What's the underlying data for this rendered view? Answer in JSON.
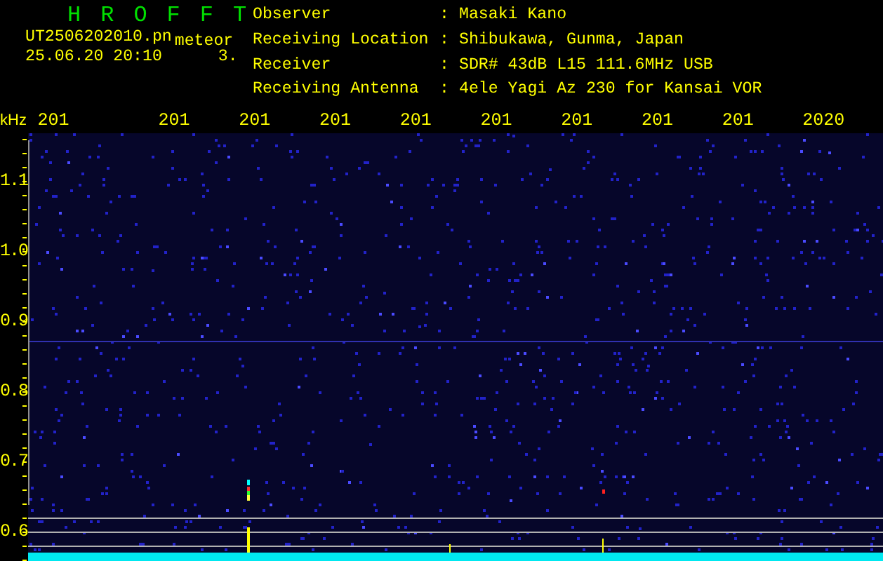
{
  "app": {
    "title": "HROFFT",
    "filename": "UT2506202010.pn",
    "mode": "meteor",
    "datetime": "25.06.20 20:10",
    "count": "3."
  },
  "info": [
    {
      "label": "Observer",
      "separator": ":",
      "value": "Masaki Kano"
    },
    {
      "label": "Receiving Location",
      "separator": ":",
      "value": "Shibukawa, Gunma, Japan"
    },
    {
      "label": "Receiver",
      "separator": ":",
      "value": "SDR# 43dB L15 111.6MHz USB"
    },
    {
      "label": "Receiving Antenna",
      "separator": ":",
      "value": "4ele Yagi Az 230 for Kansai VOR"
    }
  ],
  "axis": {
    "unit": "kHz",
    "x_labels": [
      "201",
      "201",
      "201",
      "201",
      "201",
      "201",
      "201",
      "201",
      "201",
      "2020"
    ],
    "y_labels": [
      "1.1",
      "1.0",
      "0.9",
      "0.8",
      "0.7",
      "0.6"
    ]
  }
}
